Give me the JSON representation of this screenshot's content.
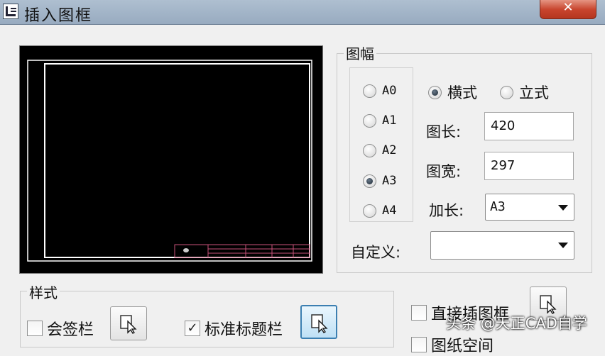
{
  "window": {
    "title": "插入图框",
    "close_label": "✕"
  },
  "paper": {
    "group_title": "图幅",
    "sizes": [
      {
        "label": "A0",
        "selected": false
      },
      {
        "label": "A1",
        "selected": false
      },
      {
        "label": "A2",
        "selected": false
      },
      {
        "label": "A3",
        "selected": true
      },
      {
        "label": "A4",
        "selected": false
      }
    ],
    "orientation": [
      {
        "label": "横式",
        "selected": true
      },
      {
        "label": "立式",
        "selected": false
      }
    ],
    "length_label": "图长:",
    "length_value": "420",
    "width_label": "图宽:",
    "width_value": "297",
    "extend_label": "加长:",
    "extend_value": "A3",
    "custom_label": "自定义:",
    "custom_value": ""
  },
  "style": {
    "group_title": "样式",
    "countersign_label": "会签栏",
    "countersign_checked": false,
    "title_block_label": "标准标题栏",
    "title_block_checked": true
  },
  "right_options": {
    "direct_label": "直接插图框",
    "second_label": "图纸空间"
  },
  "watermark": "头条 @天正CAD自学"
}
